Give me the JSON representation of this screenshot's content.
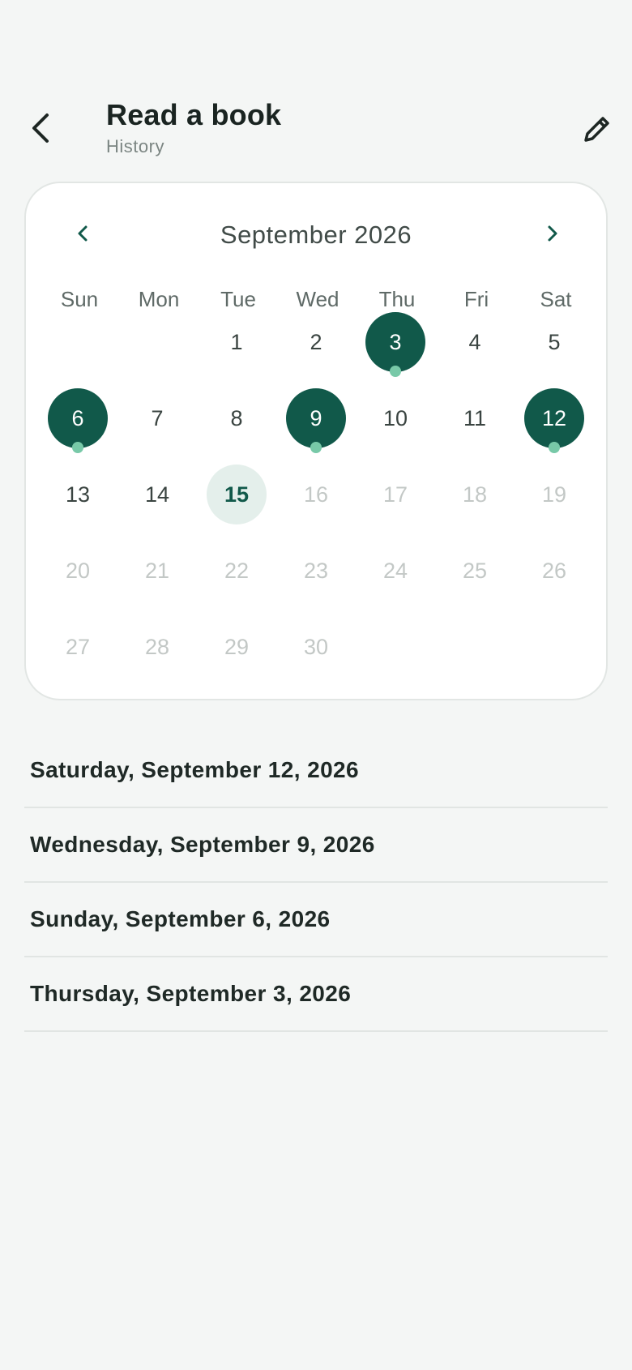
{
  "header": {
    "back_icon": "chevron-left-icon",
    "title": "Read a book",
    "subtitle": "History",
    "edit_icon": "pencil-icon"
  },
  "colors": {
    "background": "#f4f6f5",
    "accent": "#11594a",
    "today_bg": "#e4efeb",
    "dot": "#78c9a8"
  },
  "calendar": {
    "prev_icon": "chevron-left-icon",
    "next_icon": "chevron-right-icon",
    "month_label": "September 2026",
    "weekdays": [
      "Sun",
      "Mon",
      "Tue",
      "Wed",
      "Thu",
      "Fri",
      "Sat"
    ],
    "first_weekday": 2,
    "days_in_month": 30,
    "today": 15,
    "completed_days": [
      3,
      6,
      9,
      12
    ]
  },
  "history": [
    {
      "label": "Saturday, September 12, 2026"
    },
    {
      "label": "Wednesday, September 9, 2026"
    },
    {
      "label": "Sunday, September 6, 2026"
    },
    {
      "label": "Thursday, September 3, 2026"
    }
  ]
}
